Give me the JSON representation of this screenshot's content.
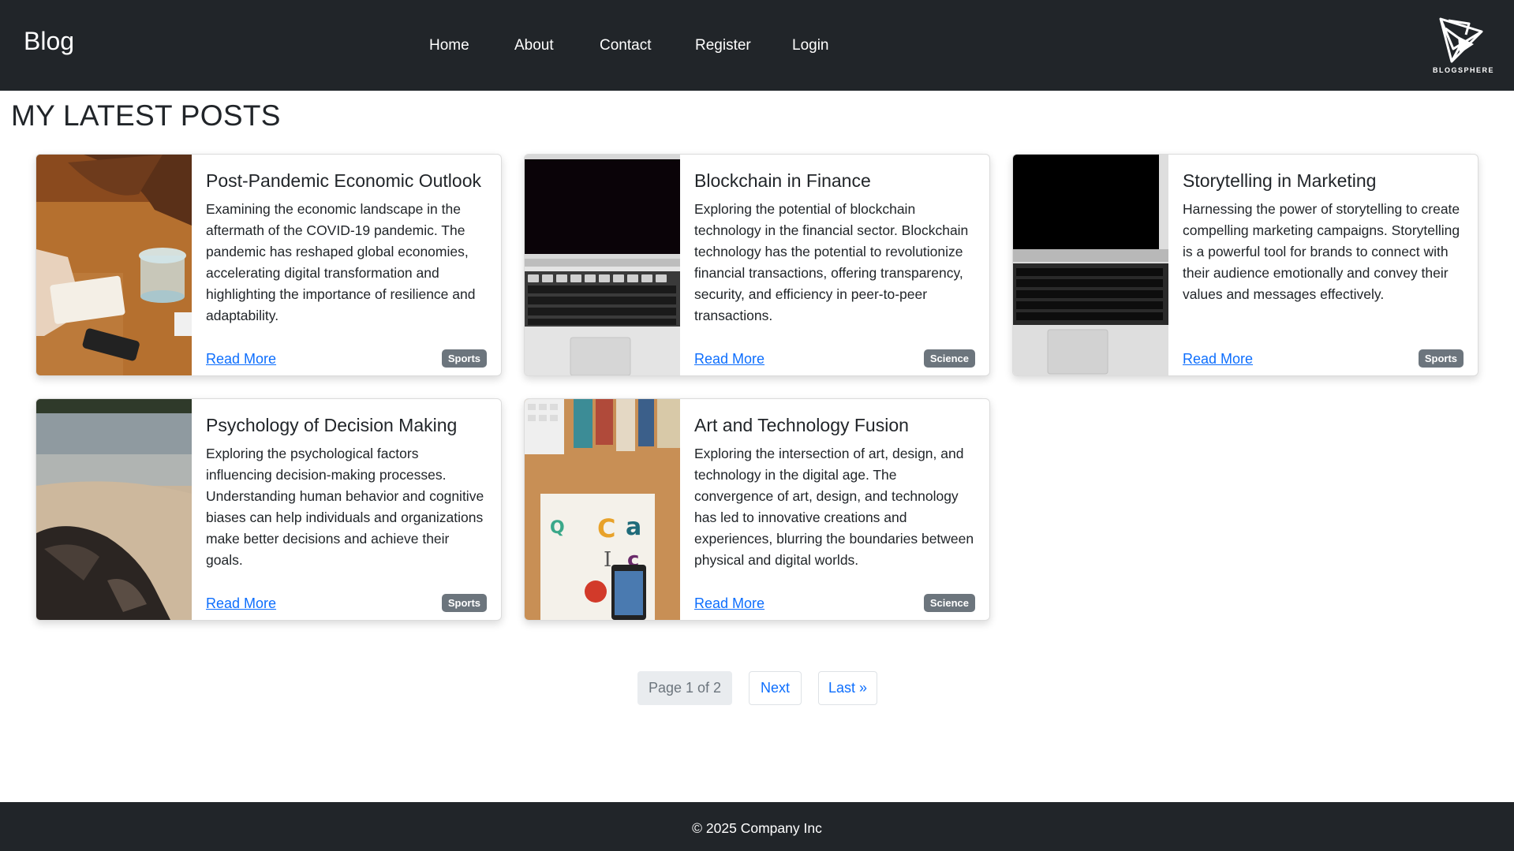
{
  "navbar": {
    "brand": "Blog",
    "links": [
      {
        "label": "Home"
      },
      {
        "label": "About"
      },
      {
        "label": "Contact"
      },
      {
        "label": "Register"
      },
      {
        "label": "Login"
      }
    ],
    "logo_text": "BLOGSPHERE"
  },
  "page": {
    "title": "MY LATEST POSTS"
  },
  "posts": [
    {
      "title": "Post-Pandemic Economic Outlook",
      "text": "Examining the economic landscape in the aftermath of the COVID-19 pandemic. The pandemic has reshaped global economies, accelerating digital transformation and highlighting the importance of resilience and adaptability.",
      "link": "Read More",
      "category": "Sports",
      "image": "person-writing-notebook-with-glass"
    },
    {
      "title": "Blockchain in Finance",
      "text": "Exploring the potential of blockchain technology in the financial sector. Blockchain technology has the potential to revolutionize financial transactions, offering transparency, security, and efficiency in peer-to-peer transactions.",
      "link": "Read More",
      "category": "Science",
      "image": "laptop-keyboard"
    },
    {
      "title": "Storytelling in Marketing",
      "text": "Harnessing the power of storytelling to create compelling marketing campaigns. Storytelling is a powerful tool for brands to connect with their audience emotionally and convey their values and messages effectively.",
      "link": "Read More",
      "category": "Sports",
      "image": "laptop-keyboard"
    },
    {
      "title": "Psychology of Decision Making",
      "text": "Exploring the psychological factors influencing decision-making processes. Understanding human behavior and cognitive biases can help individuals and organizations make better decisions and achieve their goals.",
      "link": "Read More",
      "category": "Sports",
      "image": "beach-rocks"
    },
    {
      "title": "Art and Technology Fusion",
      "text": "Exploring the intersection of art, design, and technology in the digital age. The convergence of art, design, and technology has led to innovative creations and experiences, blurring the boundaries between physical and digital worlds.",
      "link": "Read More",
      "category": "Science",
      "image": "desk-books-phone"
    }
  ],
  "pagination": {
    "current": "Page 1 of 2",
    "next": "Next",
    "last": "Last »"
  },
  "footer": {
    "text": "© 2025 Company Inc"
  },
  "colors": {
    "navbar_bg": "#212529",
    "link": "#0d6efd",
    "badge_bg": "#6c757d"
  }
}
